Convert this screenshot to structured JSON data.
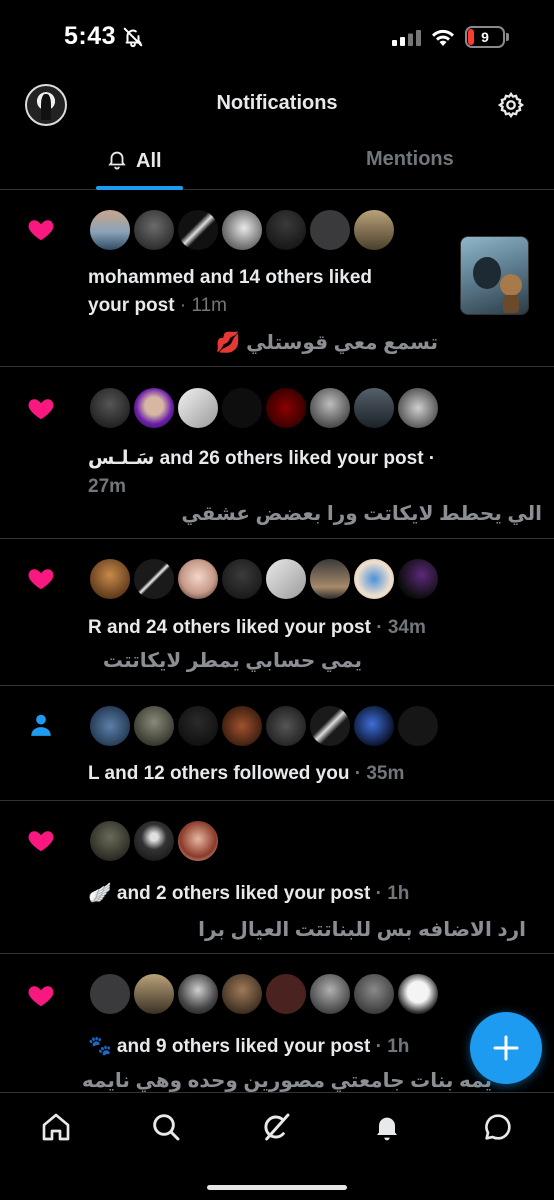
{
  "status_bar": {
    "time": "5:43",
    "battery": "9",
    "icons": [
      "bell-slash-icon",
      "cellular-signal-icon",
      "wifi-icon",
      "battery-icon"
    ]
  },
  "header": {
    "title": "Notifications",
    "settings_icon": "gear-icon"
  },
  "tabs": [
    {
      "label": "All",
      "active": true
    },
    {
      "label": "Mentions",
      "active": false
    }
  ],
  "colors": {
    "accent": "#1d9bf0",
    "like": "#f91880",
    "text": "#e7e9ea",
    "muted": "#71767b",
    "background": "#000000"
  },
  "notifications": [
    {
      "type": "like",
      "icon": "heart-icon",
      "text_line1": "mohammed and 14 others liked",
      "text_line2": "your post",
      "time": "· 11m",
      "quote": "تسمع معي قوستلي 💋",
      "avatar_count": 7,
      "has_thumbnail": true
    },
    {
      "type": "like",
      "icon": "heart-icon",
      "text_line1": "سَـلـس and 26 others liked your post ·",
      "text_line2": "27m",
      "quote": "الي يحطط لايكاتت ورا بعضض عشقي",
      "avatar_count": 8
    },
    {
      "type": "like",
      "icon": "heart-icon",
      "text_line1": "R and 24 others liked your post",
      "time": "· 34m",
      "quote": "يمي حسابي يمطر لايكاتتت",
      "avatar_count": 8
    },
    {
      "type": "follow",
      "icon": "person-icon",
      "text_line1": "L and 12 others followed you",
      "time": "· 35m",
      "avatar_count": 8
    },
    {
      "type": "like",
      "icon": "heart-icon",
      "text_line1": "🪽 and 2 others liked your post",
      "time": "· 1h",
      "quote": "ارد الاضافه بس للبناتتت العيال برا",
      "avatar_count": 3
    },
    {
      "type": "like",
      "icon": "heart-icon",
      "text_line1": "🐾 and 9 others liked your post",
      "time": "· 1h",
      "quote": "يمه بنات جامعتي مصورين وحده وهي نايمه",
      "avatar_count": 8
    }
  ],
  "fab": {
    "icon": "plus-icon"
  },
  "bottom_nav": [
    {
      "name": "home",
      "icon": "home-icon"
    },
    {
      "name": "search",
      "icon": "search-icon"
    },
    {
      "name": "grok",
      "icon": "grok-icon"
    },
    {
      "name": "notifications",
      "icon": "bell-icon",
      "active": true
    },
    {
      "name": "messages",
      "icon": "chat-bubble-icon"
    }
  ]
}
